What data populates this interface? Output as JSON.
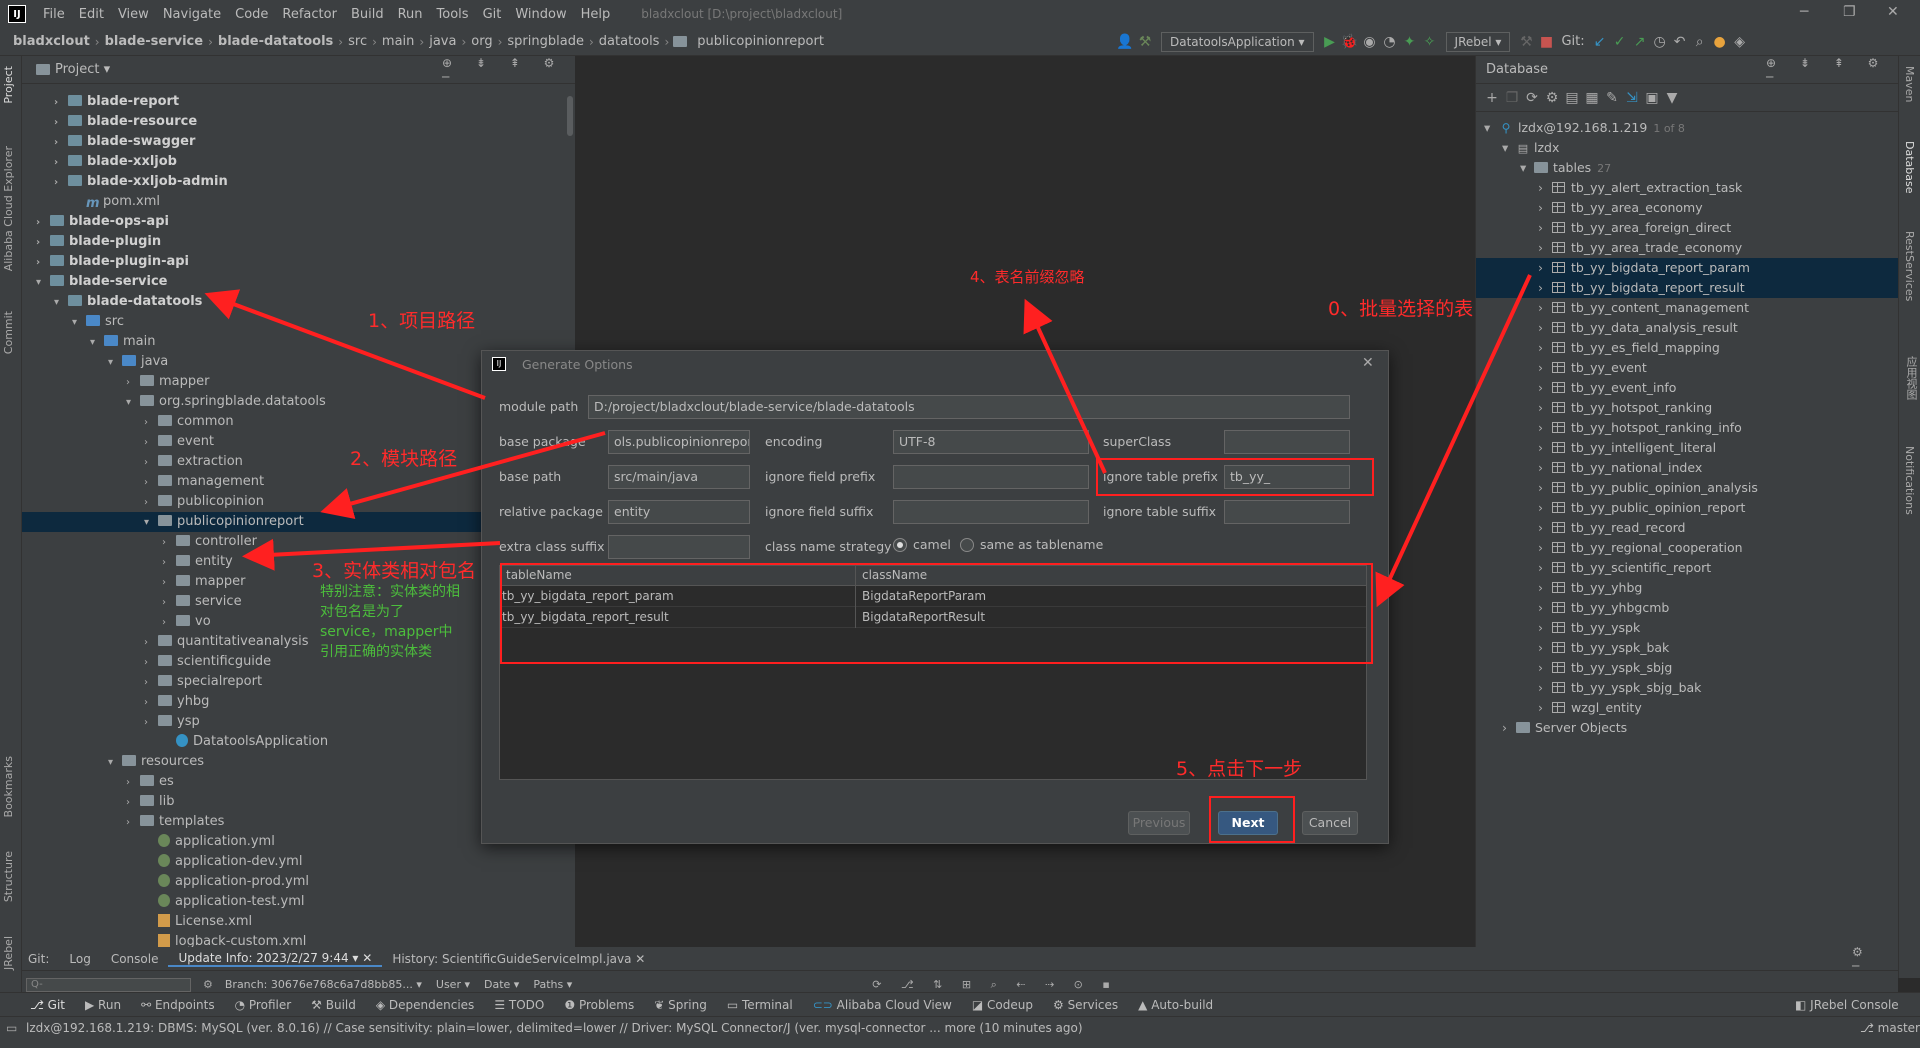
{
  "menubar": {
    "items": [
      "File",
      "Edit",
      "View",
      "Navigate",
      "Code",
      "Refactor",
      "Build",
      "Run",
      "Tools",
      "Git",
      "Window",
      "Help"
    ],
    "window_title": "bladxclout [D:\\project\\bladxclout]"
  },
  "breadcrumb": [
    "bladxclout",
    "blade-service",
    "blade-datatools",
    "src",
    "main",
    "java",
    "org",
    "springblade",
    "datatools",
    "publicopinionreport"
  ],
  "toolbar": {
    "run_config": "DatatoolsApplication",
    "jrebel": "JRebel",
    "git_label": "Git:"
  },
  "left_strip": [
    "Project",
    "Alibaba Cloud Explorer",
    "Commit",
    "Bookmarks",
    "Structure",
    "JRebel"
  ],
  "right_strip": [
    "Maven",
    "Database",
    "RestServices",
    "应用视图",
    "Notifications"
  ],
  "project_panel": {
    "title": "Project",
    "tree": [
      {
        "label": "blade-report",
        "bold": true
      },
      {
        "label": "blade-resource",
        "bold": true
      },
      {
        "label": "blade-swagger",
        "bold": true
      },
      {
        "label": "blade-xxljob",
        "bold": true
      },
      {
        "label": "blade-xxljob-admin",
        "bold": true
      },
      {
        "label": "pom.xml"
      },
      {
        "label": "blade-ops-api",
        "bold": true
      },
      {
        "label": "blade-plugin",
        "bold": true
      },
      {
        "label": "blade-plugin-api",
        "bold": true
      },
      {
        "label": "blade-service",
        "bold": true
      },
      {
        "label": "blade-datatools",
        "bold": true
      },
      {
        "label": "src"
      },
      {
        "label": "main"
      },
      {
        "label": "java"
      },
      {
        "label": "mapper"
      },
      {
        "label": "org.springblade.datatools"
      },
      {
        "label": "common"
      },
      {
        "label": "event"
      },
      {
        "label": "extraction"
      },
      {
        "label": "management"
      },
      {
        "label": "publicopinion"
      },
      {
        "label": "publicopinionreport"
      },
      {
        "label": "controller"
      },
      {
        "label": "entity"
      },
      {
        "label": "mapper"
      },
      {
        "label": "service"
      },
      {
        "label": "vo"
      },
      {
        "label": "quantitativeanalysis"
      },
      {
        "label": "scientificguide"
      },
      {
        "label": "specialreport"
      },
      {
        "label": "yhbg"
      },
      {
        "label": "ysp"
      },
      {
        "label": "DatatoolsApplication"
      },
      {
        "label": "resources"
      },
      {
        "label": "es"
      },
      {
        "label": "lib"
      },
      {
        "label": "templates"
      },
      {
        "label": "application.yml"
      },
      {
        "label": "application-dev.yml"
      },
      {
        "label": "application-prod.yml"
      },
      {
        "label": "application-test.yml"
      },
      {
        "label": "License.xml"
      },
      {
        "label": "logback-custom.xml"
      }
    ]
  },
  "database_panel": {
    "title": "Database",
    "connection": "lzdx@192.168.1.219",
    "connection_count": "1 of 8",
    "schema": "lzdx",
    "tables_label": "tables",
    "tables_count": "27",
    "tables": [
      "tb_yy_alert_extraction_task",
      "tb_yy_area_economy",
      "tb_yy_area_foreign_direct",
      "tb_yy_area_trade_economy",
      "tb_yy_bigdata_report_param",
      "tb_yy_bigdata_report_result",
      "tb_yy_content_management",
      "tb_yy_data_analysis_result",
      "tb_yy_es_field_mapping",
      "tb_yy_event",
      "tb_yy_event_info",
      "tb_yy_hotspot_ranking",
      "tb_yy_hotspot_ranking_info",
      "tb_yy_intelligent_literal",
      "tb_yy_national_index",
      "tb_yy_public_opinion_analysis",
      "tb_yy_public_opinion_report",
      "tb_yy_read_record",
      "tb_yy_regional_cooperation",
      "tb_yy_scientific_report",
      "tb_yy_yhbg",
      "tb_yy_yhbgcmb",
      "tb_yy_yspk",
      "tb_yy_yspk_bak",
      "tb_yy_yspk_sbjg",
      "tb_yy_yspk_sbjg_bak",
      "wzgl_entity"
    ],
    "server_objects": "Server Objects"
  },
  "dialog": {
    "title": "Generate Options",
    "module_path_label": "module path",
    "module_path": "D:/project/bladxclout/blade-service/blade-datatools",
    "base_package_label": "base package",
    "base_package": "ols.publicopinionreport",
    "encoding_label": "encoding",
    "encoding": "UTF-8",
    "superclass_label": "superClass",
    "superclass": "",
    "base_path_label": "base path",
    "base_path": "src/main/java",
    "ignore_field_prefix_label": "ignore field prefix",
    "ignore_field_prefix": "",
    "ignore_table_prefix_label": "ignore table prefix",
    "ignore_table_prefix": "tb_yy_",
    "relative_package_label": "relative package",
    "relative_package": "entity",
    "ignore_field_suffix_label": "ignore field suffix",
    "ignore_field_suffix": "",
    "ignore_table_suffix_label": "ignore table suffix",
    "ignore_table_suffix": "",
    "extra_class_suffix_label": "extra class suffix",
    "extra_class_suffix": "",
    "class_name_strategy_label": "class name strategy",
    "strategy_camel": "camel",
    "strategy_same": "same as tablename",
    "table_headers": [
      "tableName",
      "className"
    ],
    "table_rows": [
      [
        "tb_yy_bigdata_report_param",
        "BigdataReportParam"
      ],
      [
        "tb_yy_bigdata_report_result",
        "BigdataReportResult"
      ]
    ],
    "previous": "Previous",
    "next": "Next",
    "cancel": "Cancel"
  },
  "annotations": {
    "a0": "0、批量选择的表",
    "a1": "1、项目路径",
    "a2": "2、模块路径",
    "a3": "3、实体类相对包名",
    "a4": "4、表名前缀忽略",
    "a5": "5、点击下一步",
    "note": "特别注意：实体类的相对包名是为了service，mapper中引用正确的实体类"
  },
  "git_panel": {
    "tabs": [
      "Git:",
      "Log",
      "Console",
      "Update Info: 2023/2/27 9:44",
      "History: ScientificGuideServiceImpl.java"
    ],
    "search_placeholder": "Q-",
    "branch": "Branch: 30676e768c6a7d8bb85...",
    "filters": [
      "User",
      "Date",
      "Paths"
    ]
  },
  "bottom_tabs": [
    "Git",
    "Run",
    "Endpoints",
    "Profiler",
    "Build",
    "Dependencies",
    "TODO",
    "Problems",
    "Spring",
    "Terminal",
    "Alibaba Cloud View",
    "Codeup",
    "Services",
    "Auto-build",
    "JRebel Console"
  ],
  "status": {
    "text": "lzdx@192.168.1.219: DBMS: MySQL (ver. 8.0.16) // Case sensitivity: plain=lower, delimited=lower // Driver: MySQL Connector/J (ver. mysql-connector ... more (10 minutes ago)",
    "branch": "master"
  }
}
